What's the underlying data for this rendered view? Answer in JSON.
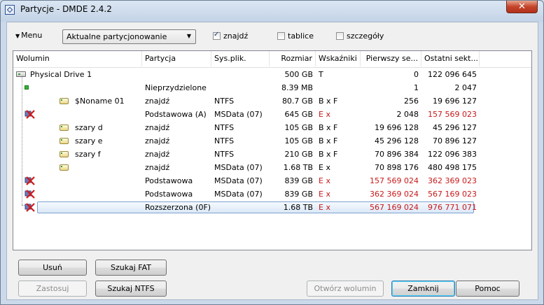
{
  "window": {
    "title": "Partycje - DMDE 2.4.2",
    "close_label": "✕"
  },
  "toolbar": {
    "menu_label": "Menu",
    "mode_select": "Aktualne partycjonowanie",
    "checkbox_find": {
      "label": "znajdź",
      "checked": true
    },
    "checkbox_tables": {
      "label": "tablice",
      "checked": false
    },
    "checkbox_details": {
      "label": "szczegóły",
      "checked": false
    }
  },
  "table": {
    "columns": [
      "Wolumin",
      "Partycja",
      "Sys.plik.",
      "Rozmiar",
      "Wskaźniki",
      "Pierwszy se...",
      "Ostatni sekt..."
    ],
    "rows": [
      {
        "wolumin": "Physical Drive 1",
        "partycja": "",
        "sysplik": "",
        "rozmiar": "500 GB",
        "wskazniki": "T",
        "pierwszy": "0",
        "ostatni": "122 096 645",
        "icon": "drive-icon",
        "red": false
      },
      {
        "wolumin": "",
        "partycja": "Nieprzydzielone",
        "sysplik": "",
        "rozmiar": "8.39 MB",
        "wskazniki": "",
        "pierwszy": "1",
        "ostatni": "2 047",
        "icon": "unallocated-icon",
        "red": false
      },
      {
        "wolumin": "$Noname 01",
        "partycja": "znajdź",
        "sysplik": "NTFS",
        "rozmiar": "80.7 GB",
        "wskazniki": "B x F",
        "pierwszy": "256",
        "ostatni": "19 696 127",
        "icon": "volume-icon",
        "red": false
      },
      {
        "wolumin": "",
        "partycja": "Podstawowa (A)",
        "sysplik": "MSData (07)",
        "rozmiar": "645 GB",
        "wskazniki": "E x",
        "pierwszy": "2 048",
        "ostatni": "157 569 023",
        "icon": "invalid-partition-icon",
        "red": true,
        "red_first": false
      },
      {
        "wolumin": "szary d",
        "partycja": "znajdź",
        "sysplik": "NTFS",
        "rozmiar": "105 GB",
        "wskazniki": "B x F",
        "pierwszy": "19 696 128",
        "ostatni": "45 296 127",
        "icon": "volume-icon",
        "red": false
      },
      {
        "wolumin": "szary e",
        "partycja": "znajdź",
        "sysplik": "NTFS",
        "rozmiar": "105 GB",
        "wskazniki": "B x F",
        "pierwszy": "45 296 128",
        "ostatni": "70 896 127",
        "icon": "volume-icon",
        "red": false
      },
      {
        "wolumin": "szary f",
        "partycja": "znajdź",
        "sysplik": "NTFS",
        "rozmiar": "210 GB",
        "wskazniki": "B x F",
        "pierwszy": "70 896 384",
        "ostatni": "122 096 383",
        "icon": "volume-icon",
        "red": false
      },
      {
        "wolumin": "",
        "partycja": "znajdź",
        "sysplik": "MSData (07)",
        "rozmiar": "1.68 TB",
        "wskazniki": "E x",
        "pierwszy": "70 898 176",
        "ostatni": "480 498 175",
        "icon": "volume-icon",
        "red": false
      },
      {
        "wolumin": "",
        "partycja": "Podstawowa",
        "sysplik": "MSData (07)",
        "rozmiar": "839 GB",
        "wskazniki": "E x",
        "pierwszy": "157 569 024",
        "ostatni": "362 369 023",
        "icon": "invalid-partition-icon",
        "red": true,
        "red_first": true
      },
      {
        "wolumin": "",
        "partycja": "Podstawowa",
        "sysplik": "MSData (07)",
        "rozmiar": "839 GB",
        "wskazniki": "E x",
        "pierwszy": "362 369 024",
        "ostatni": "567 169 023",
        "icon": "invalid-partition-icon",
        "red": true,
        "red_first": true
      },
      {
        "wolumin": "",
        "partycja": "Rozszerzona    (0F)",
        "sysplik": "",
        "rozmiar": "1.68 TB",
        "wskazniki": "E x",
        "pierwszy": "567 169 024",
        "ostatni": "976 771 071",
        "icon": "invalid-partition-icon",
        "red": true,
        "red_first": true,
        "selected": true
      }
    ]
  },
  "buttons": {
    "delete": "Usuń",
    "scan_fat": "Szukaj FAT",
    "apply": "Zastosuj",
    "scan_ntfs": "Szukaj NTFS",
    "open_volume": "Otwórz wolumin",
    "close": "Zamknij",
    "help": "Pomoc"
  },
  "colors": {
    "error_red": "#c8191a",
    "selection_border": "#7da2ce"
  }
}
